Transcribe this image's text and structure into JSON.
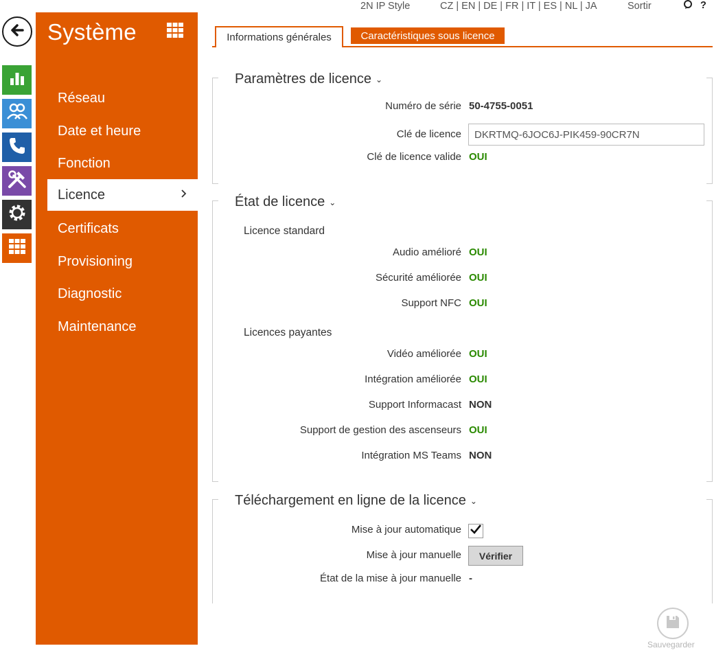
{
  "topbar": {
    "product": "2N IP Style",
    "languages": "CZ | EN | DE | FR | IT | ES | NL | JA",
    "logout": "Sortir",
    "help": "?"
  },
  "rail": [
    {
      "icon": "chart-icon",
      "color": "#3aa335"
    },
    {
      "icon": "users-icon",
      "color": "#3a8fd6"
    },
    {
      "icon": "phone-icon",
      "color": "#1f5fa8"
    },
    {
      "icon": "tools-icon",
      "color": "#7a4aa8"
    },
    {
      "icon": "gear-icon",
      "color": "#333333"
    },
    {
      "icon": "apps-grid-icon",
      "color": "#e05a00"
    }
  ],
  "sidebar": {
    "title": "Système",
    "items": [
      {
        "label": "Réseau"
      },
      {
        "label": "Date et heure"
      },
      {
        "label": "Fonction"
      },
      {
        "label": "Licence",
        "active": true
      },
      {
        "label": "Certificats"
      },
      {
        "label": "Provisioning"
      },
      {
        "label": "Diagnostic"
      },
      {
        "label": "Maintenance"
      }
    ]
  },
  "tabs": {
    "general": "Informations générales",
    "licensed": "Caractéristiques sous licence"
  },
  "license_params": {
    "title": "Paramètres de licence",
    "serial_label": "Numéro de série",
    "serial_value": "50-4755-0051",
    "key_label": "Clé de licence",
    "key_value": "DKRTMQ-6JOC6J-PIK459-90CR7N",
    "valid_label": "Clé de licence valide",
    "valid_value": "OUI"
  },
  "license_state": {
    "title": "État de licence",
    "standard_heading": "Licence standard",
    "standard": [
      {
        "label": "Audio amélioré",
        "value": "OUI",
        "ok": true
      },
      {
        "label": "Sécurité améliorée",
        "value": "OUI",
        "ok": true
      },
      {
        "label": "Support NFC",
        "value": "OUI",
        "ok": true
      }
    ],
    "paid_heading": "Licences payantes",
    "paid": [
      {
        "label": "Vidéo améliorée",
        "value": "OUI",
        "ok": true
      },
      {
        "label": "Intégration améliorée",
        "value": "OUI",
        "ok": true
      },
      {
        "label": "Support Informacast",
        "value": "NON",
        "ok": false
      },
      {
        "label": "Support de gestion des ascenseurs",
        "value": "OUI",
        "ok": true
      },
      {
        "label": "Intégration MS Teams",
        "value": "NON",
        "ok": false
      }
    ]
  },
  "online_download": {
    "title": "Téléchargement en ligne de la licence",
    "auto_label": "Mise à jour automatique",
    "auto_checked": true,
    "manual_label": "Mise à jour manuelle",
    "verify_button": "Vérifier",
    "status_label": "État de la mise à jour manuelle",
    "status_value": "-"
  },
  "save": {
    "label": "Sauvegarder"
  },
  "colors": {
    "brand": "#e05a00",
    "ok": "#2a8a00"
  }
}
